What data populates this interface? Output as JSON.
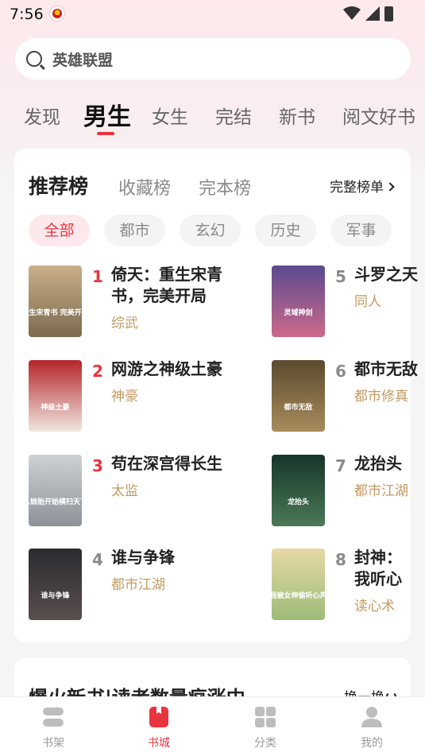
{
  "status_bar": {
    "time": "7:56"
  },
  "search": {
    "placeholder": "英雄联盟"
  },
  "channel_tabs": [
    "发现",
    "男生",
    "女生",
    "完结",
    "新书",
    "阅文好书"
  ],
  "ranking": {
    "tabs": [
      "推荐榜",
      "收藏榜",
      "完本榜"
    ],
    "full_list_label": "完整榜单",
    "categories": [
      "全部",
      "都市",
      "玄幻",
      "历史",
      "军事"
    ],
    "books": [
      {
        "rank": "1",
        "title": "倚天：重生宋青书，完美开局",
        "tag": "综武"
      },
      {
        "rank": "2",
        "title": "网游之神级土豪",
        "tag": "神豪"
      },
      {
        "rank": "3",
        "title": "苟在深宫得长生",
        "tag": "太监"
      },
      {
        "rank": "4",
        "title": "谁与争锋",
        "tag": "都市江湖"
      },
      {
        "rank": "5",
        "title": "斗罗之天",
        "tag": "同人"
      },
      {
        "rank": "6",
        "title": "都市无敌",
        "tag": "都市修真"
      },
      {
        "rank": "7",
        "title": "龙抬头",
        "tag": "都市江湖"
      },
      {
        "rank": "8",
        "title": "封神：我听心声！",
        "tag": "读心术"
      }
    ],
    "covers": [
      {
        "text": "重生宋青书 完美开局",
        "colors": [
          "#c9b08a",
          "#7c6a4e"
        ]
      },
      {
        "text": "神级土豪",
        "colors": [
          "#b3252a",
          "#f1e8e2"
        ]
      },
      {
        "text": "从娘胎开始横扫天下",
        "colors": [
          "#cfd2d4",
          "#8c9298"
        ]
      },
      {
        "text": "谁与争锋",
        "colors": [
          "#2b2b30",
          "#5a4e4e"
        ]
      },
      {
        "text": "灵域神剑",
        "colors": [
          "#5a4a8f",
          "#cc6a8a"
        ]
      },
      {
        "text": "都市无敌",
        "colors": [
          "#5b4a2e",
          "#a88c5c"
        ]
      },
      {
        "text": "龙抬头",
        "colors": [
          "#16352a",
          "#4b7a56"
        ]
      },
      {
        "text": "我被女神偷听心声",
        "colors": [
          "#e6d9a6",
          "#9cbc78"
        ]
      }
    ]
  },
  "second_section": {
    "title": "爆火新书|读者数量疯涨中",
    "refresh_label": "换一换"
  },
  "bottom_nav": [
    {
      "label": "书架",
      "icon": "bookshelf-icon"
    },
    {
      "label": "书城",
      "icon": "bookstore-icon"
    },
    {
      "label": "分类",
      "icon": "category-icon"
    },
    {
      "label": "我的",
      "icon": "profile-icon"
    }
  ],
  "colors": {
    "accent": "#e8343f",
    "tag": "#c49a62",
    "rank_top": "#e8343f",
    "rank_other": "#8a8a8a"
  }
}
